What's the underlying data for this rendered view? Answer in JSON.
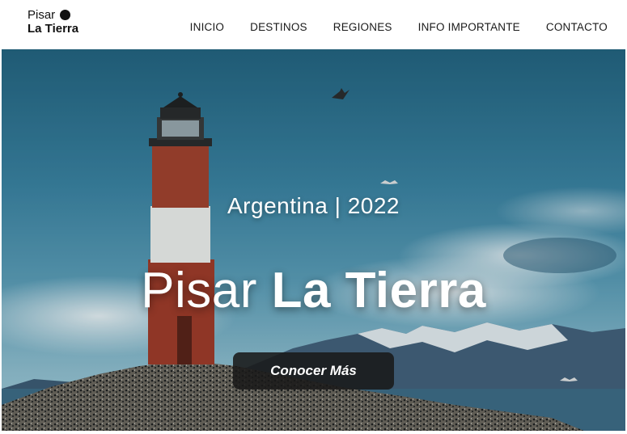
{
  "logo": {
    "line1": "Pisar",
    "line2": "La Tierra",
    "dot_icon": "filled-circle"
  },
  "nav": {
    "items": [
      {
        "label": "INICIO"
      },
      {
        "label": "DESTINOS"
      },
      {
        "label": "REGIONES"
      },
      {
        "label": "INFO IMPORTANTE"
      },
      {
        "label": "CONTACTO"
      }
    ]
  },
  "hero": {
    "subtitle": "Argentina | 2022",
    "title_light": "Pisar ",
    "title_bold": "La Tierra",
    "cta_label": "Conocer Más",
    "image": "lighthouse-on-rocky-island"
  },
  "colors": {
    "cta_background": "#191919",
    "lighthouse_red": "#a23a26",
    "lighthouse_white": "#f2f2ee",
    "sky": "#3f87a6"
  }
}
